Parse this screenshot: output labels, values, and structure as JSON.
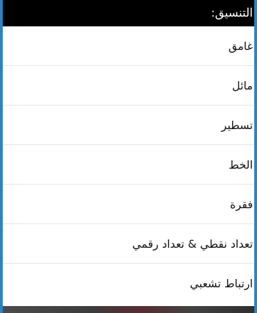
{
  "menu": {
    "title": "التنسيق:",
    "items": [
      {
        "label": "غامق"
      },
      {
        "label": "مائل"
      },
      {
        "label": "تسطير"
      },
      {
        "label": "الخط"
      },
      {
        "label": "فقرة"
      },
      {
        "label": "تعداد نقطي & تعداد رقمي"
      },
      {
        "label": "ارتباط تشعبي"
      }
    ]
  },
  "colors": {
    "border_accent": "#2d83c4",
    "header_bg": "#000000",
    "header_text": "#ffffff",
    "item_text": "#111111",
    "divider": "#e6e6e6"
  }
}
